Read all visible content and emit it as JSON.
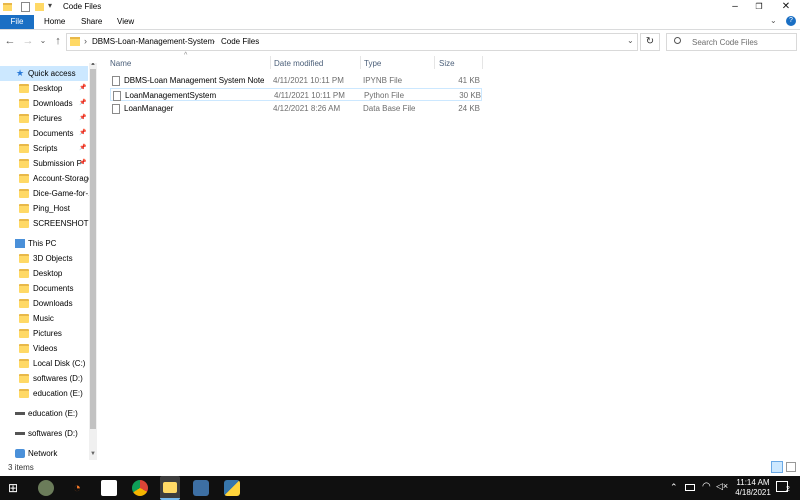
{
  "window": {
    "title": "Code Files"
  },
  "ribbon": {
    "tabs": [
      "File",
      "Home",
      "Share",
      "View"
    ]
  },
  "address": {
    "crumbs": [
      "DBMS-Loan-Management-System",
      "Code Files"
    ],
    "search_placeholder": "Search Code Files"
  },
  "columns": {
    "name": "Name",
    "date": "Date modified",
    "type": "Type",
    "size": "Size"
  },
  "files": [
    {
      "name": "DBMS-Loan Management System Noteb...",
      "date": "4/11/2021 10:11 PM",
      "type": "IPYNB File",
      "size": "41 KB",
      "icon": "notebook-file-icon"
    },
    {
      "name": "LoanManagementSystem",
      "date": "4/11/2021 10:11 PM",
      "type": "Python File",
      "size": "30 KB",
      "icon": "python-file-icon"
    },
    {
      "name": "LoanManager",
      "date": "4/12/2021 8:26 AM",
      "type": "Data Base File",
      "size": "24 KB",
      "icon": "database-file-icon"
    }
  ],
  "nav": {
    "quick_access": "Quick access",
    "quick_items": [
      "Desktop",
      "Downloads",
      "Pictures",
      "Documents",
      "Scripts",
      "Submission P",
      "Account-Storage",
      "Dice-Game-for-...",
      "Ping_Host",
      "SCREENSHOTS"
    ],
    "this_pc": "This PC",
    "pc_items": [
      "3D Objects",
      "Desktop",
      "Documents",
      "Downloads",
      "Music",
      "Pictures",
      "Videos",
      "Local Disk (C:)",
      "softwares (D:)",
      "education (E:)"
    ],
    "drives": [
      "education (E:)",
      "softwares (D:)"
    ],
    "network": "Network"
  },
  "status": {
    "items": "3 items"
  },
  "taskbar": {
    "time": "11:14 AM",
    "date": "4/18/2021",
    "notification_count": "2"
  },
  "colors": {
    "accent": "#1a6fc4",
    "folder": "#ffd966",
    "taskbar": "#101010"
  }
}
